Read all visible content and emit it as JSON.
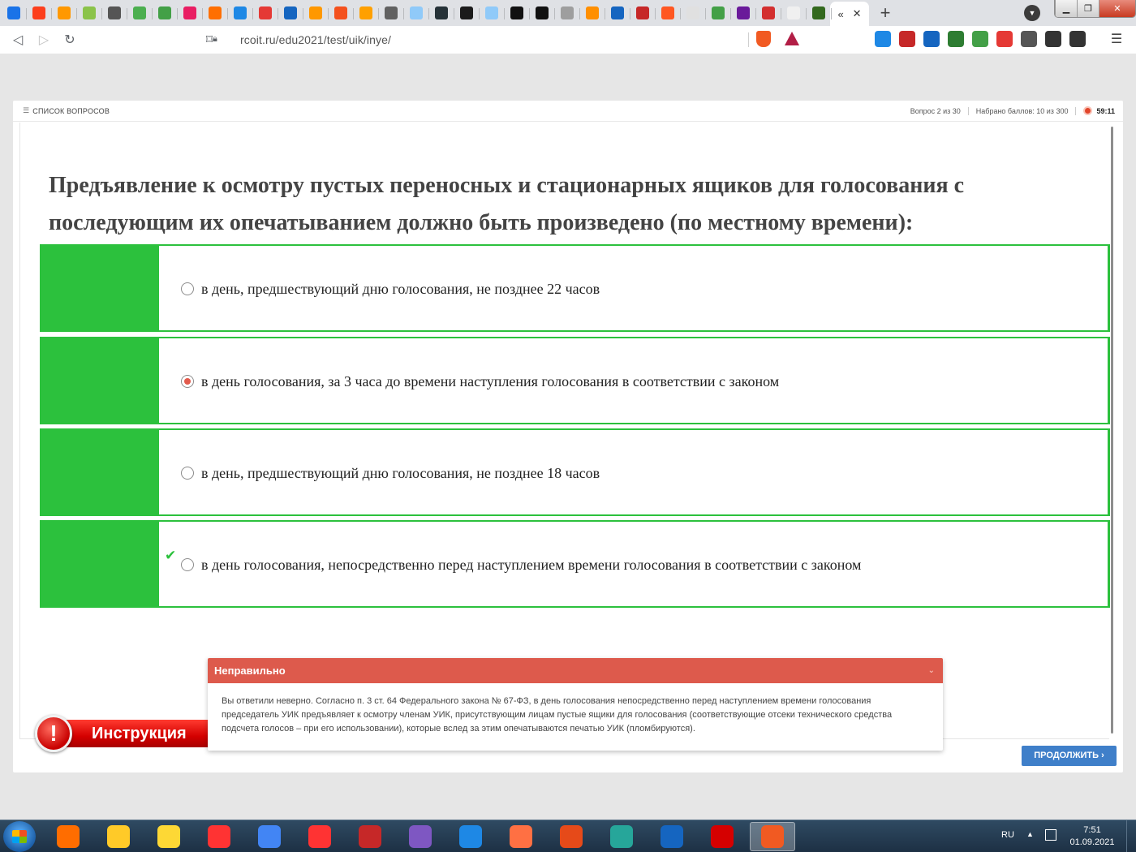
{
  "browser": {
    "url": "rcoit.ru/edu2021/test/uik/inye/",
    "tab_fav_colors": [
      "#1a73e8",
      "#fc3f1d",
      "#ff9800",
      "#8bc34a",
      "#555555",
      "#4caf50",
      "#43a047",
      "#e91e63",
      "#ff6f00",
      "#1e88e5",
      "#e53935",
      "#1565c0",
      "#ff9800",
      "#f4511e",
      "#ffa000",
      "#616161",
      "#90caf9",
      "#263238",
      "#1b1b1b",
      "#90caf9",
      "#111111",
      "#111111",
      "#9e9e9e",
      "#ff8f00",
      "#1565c0",
      "#c62828",
      "#ff5722",
      "#e0e0e0",
      "#43a047",
      "#6a1b9a",
      "#d32f2f",
      "#f0f0f0",
      "#33691e"
    ],
    "tab_active_label": "«",
    "tab_close": "✕",
    "new_tab": "+",
    "window_controls": {
      "minimize": "▁",
      "maximize": "❐",
      "close": "✕"
    },
    "extension_colors": [
      "#1e88e5",
      "#c62828",
      "#1565c0",
      "#2e7d32",
      "#43a047",
      "#e53935",
      "#555555",
      "#333333",
      "#333333"
    ]
  },
  "quiz": {
    "questions_list_label": "СПИСОК ВОПРОСОВ",
    "question_counter": "Вопрос 2 из 30",
    "score": "Набрано баллов: 10 из 300",
    "timer": "59:11",
    "question_text": "Предъявление к осмотру пустых переносных и стационарных ящиков для голосования с последующим их опечатыванием должно быть произведено (по местному времени):",
    "answers": [
      {
        "text": "в день, предшествующий дню голосования, не позднее 22 часов",
        "selected": false,
        "correct": false
      },
      {
        "text": "в день голосования, за 3 часа до времени наступления голосования в соответствии с законом",
        "selected": true,
        "correct": false
      },
      {
        "text": "в день, предшествующий дню голосования, не позднее 18 часов",
        "selected": false,
        "correct": false
      },
      {
        "text": "в день голосования, непосредственно перед наступлением времени голосования в соответствии с законом",
        "selected": false,
        "correct": true
      }
    ],
    "correct_mark": "✔",
    "instruction_label": "Инструкция",
    "instruction_icon": "!",
    "feedback": {
      "title": "Неправильно",
      "text": "Вы ответили неверно. Согласно п. 3 ст. 64 Федерального закона № 67-ФЗ, в день голосования непосредственно перед наступлением времени голосования председатель УИК предъявляет к осмотру членам УИК, присутствующим лицам пустые ящики для голосования (соответствующие отсеки технического средства подсчета голосов – при его использовании), которые вслед за этим опечатываются печатью УИК (пломбируются)."
    },
    "continue_label": "ПРОДОЛЖИТЬ ›",
    "colors": {
      "correct_green": "#2cc13d",
      "wrong_red": "#dd5a4c",
      "continue_blue": "#3f7fc9"
    }
  },
  "taskbar": {
    "language": "RU",
    "time": "7:51",
    "date": "01.09.2021",
    "app_colors": [
      "#ff6d00",
      "#ffca28",
      "#fdd835",
      "#ff3333",
      "#4285f4",
      "#ff3333",
      "#c62828",
      "#7e57c2",
      "#1e88e5",
      "#ff7043",
      "#e64a19",
      "#26a69a",
      "#1565c0",
      "#d50000",
      "#f15a22"
    ]
  }
}
